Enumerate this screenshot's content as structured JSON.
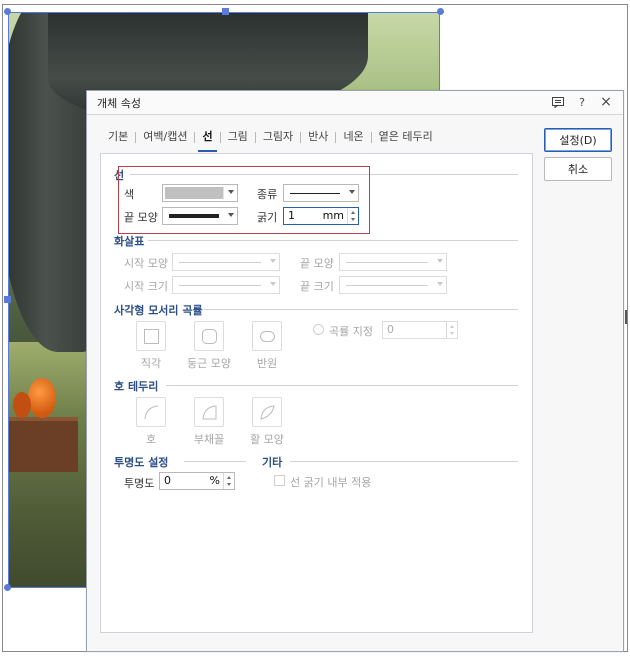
{
  "dialog": {
    "title": "개체 속성",
    "icons": {
      "help": "?",
      "close": "×"
    }
  },
  "tabs": [
    {
      "label": "기본",
      "active": false
    },
    {
      "label": "여백/캡션",
      "active": false
    },
    {
      "label": "선",
      "active": true
    },
    {
      "label": "그림",
      "active": false
    },
    {
      "label": "그림자",
      "active": false
    },
    {
      "label": "반사",
      "active": false
    },
    {
      "label": "네온",
      "active": false
    },
    {
      "label": "옅은 테두리",
      "active": false
    }
  ],
  "buttons": {
    "ok": "설정(D)",
    "cancel": "취소"
  },
  "line": {
    "section": "선",
    "color_label": "색",
    "color_value": "#c0c0c0",
    "type_label": "종류",
    "end_label": "끝 모양",
    "thickness_label": "굵기",
    "thickness_value": "1",
    "thickness_unit": "mm"
  },
  "arrow": {
    "section": "화살표",
    "start_shape": "시작 모양",
    "end_shape": "끝 모양",
    "start_size": "시작 크기",
    "end_size": "끝 크기"
  },
  "corner": {
    "section": "사각형 모서리 곡률",
    "square": "직각",
    "rounded": "둥근 모양",
    "semicircle": "반원",
    "curvature_label": "곡률 지정",
    "curvature_value": "0"
  },
  "arc": {
    "section": "호 테두리",
    "arc": "호",
    "chord": "부채꼴",
    "bow": "활 모양"
  },
  "transparency": {
    "section": "투명도 설정",
    "label": "투명도",
    "value": "0",
    "unit": "%"
  },
  "etc": {
    "section": "기타",
    "inner_line": "선 굵기 내부 적용"
  },
  "colors": {
    "accent": "#2a5db0",
    "section": "#2c4f86",
    "highlight": "#b54048"
  }
}
